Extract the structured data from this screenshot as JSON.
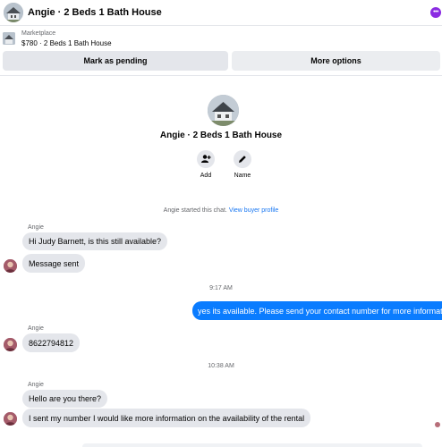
{
  "header": {
    "title": "Angie · 2 Beds 1 Bath House",
    "more_icon": "more-dots-icon",
    "accent_color": "#8a2be2"
  },
  "listing": {
    "source": "Marketplace",
    "price_title": "$780 · 2 Beds 1 Bath House"
  },
  "actions": {
    "pending_label": "Mark as pending",
    "more_label": "More options"
  },
  "profile": {
    "name": "Angie · 2 Beds 1 Bath House",
    "add_label": "Add",
    "name_label": "Name"
  },
  "chat_start": {
    "text": "Angie started this chat. ",
    "link": "View buyer profile"
  },
  "messages": [
    {
      "sender": "Angie",
      "text": "Hi Judy Barnett, is this still available?"
    },
    {
      "text": "Message sent"
    },
    {
      "timestamp": "9:17 AM"
    },
    {
      "text": "yes its available. Please send your contact number for more information"
    },
    {
      "sender": "Angie",
      "text": "8622794812"
    },
    {
      "timestamp": "10:38 AM"
    },
    {
      "sender": "Angie",
      "text": "Hello are you there?"
    },
    {
      "text": "I sent my number I would like more information on the availability of the rental"
    }
  ],
  "colors": {
    "outgoing_bubble": "#0a7cff",
    "incoming_bubble": "#e4e6eb",
    "link": "#1877f2"
  }
}
